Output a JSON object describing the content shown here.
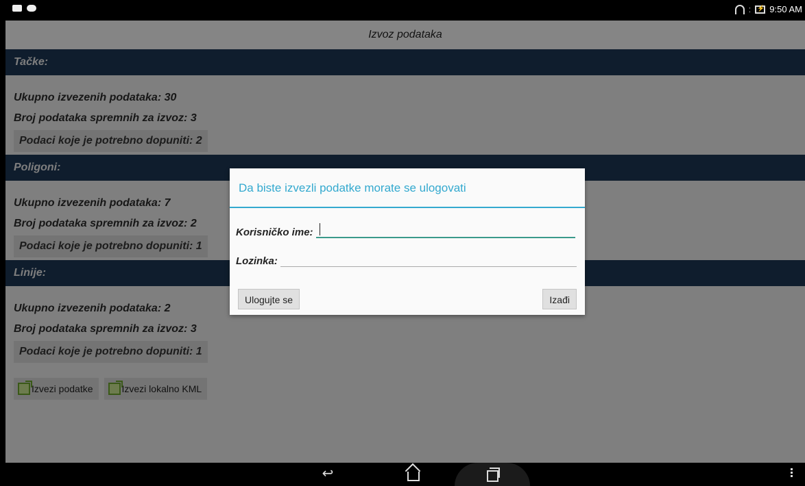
{
  "status_bar": {
    "time": "9:50 AM"
  },
  "title": "Izvoz podataka",
  "sections": [
    {
      "header": "Tačke:",
      "total": "Ukupno izvezenih podataka: 30",
      "ready": "Broj podataka spremnih za izvoz: 3",
      "need": "Podaci koje je potrebno dopuniti: 2"
    },
    {
      "header": "Poligoni:",
      "total": "Ukupno izvezenih podataka: 7",
      "ready": "Broj podataka spremnih za izvoz: 2",
      "need": "Podaci koje je potrebno dopuniti: 1"
    },
    {
      "header": "Linije:",
      "total": "Ukupno izvezenih podataka: 2",
      "ready": "Broj podataka spremnih za izvoz: 3",
      "need": "Podaci koje je potrebno dopuniti: 1"
    }
  ],
  "buttons": {
    "export": "Izvezi podatke",
    "export_kml": "Izvezi lokalno KML"
  },
  "dialog": {
    "title": "Da biste izvezli podatke morate se ulogovati",
    "username_label": "Korisničko ime:",
    "username_value": "",
    "password_label": "Lozinka:",
    "password_value": "",
    "login": "Ulogujte se",
    "exit": "Izađi"
  },
  "colors": {
    "section_header": "#1c3553",
    "dialog_accent": "#33a9cf",
    "field_focus": "#3a9a8a"
  },
  "icons": {
    "status_left": [
      "gallery-icon",
      "game-controller-icon"
    ],
    "status_right": [
      "wifi-icon",
      "battery-charging-icon"
    ],
    "nav": [
      "back-icon",
      "home-icon",
      "recent-apps-icon",
      "overflow-menu-icon"
    ]
  }
}
